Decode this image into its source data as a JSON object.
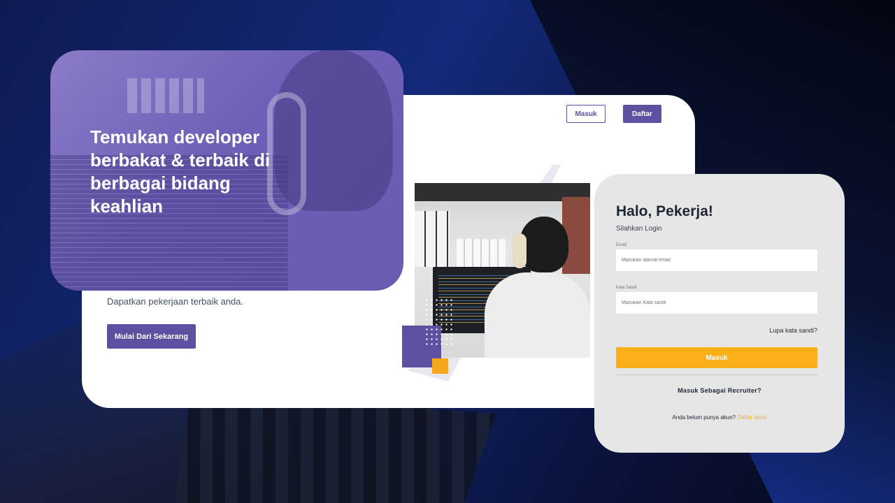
{
  "hero": {
    "title": "Temukan developer berbakat & terbaik di berbagai bidang keahlian"
  },
  "nav": {
    "login_label": "Masuk",
    "register_label": "Daftar"
  },
  "landing": {
    "subtitle": "Dapatkan pekerjaan terbaik anda.",
    "cta_label": "Mulai Dari Sekarang"
  },
  "login": {
    "title": "Halo, Pekerja!",
    "subtitle": "Silahkan Login",
    "email_label": "Email",
    "email_placeholder": "Masukan alamat email",
    "password_label": "Kata Sandi",
    "password_placeholder": "Masukan Kata sandi",
    "forgot_label": "Lupa kata sandi?",
    "submit_label": "Masuk",
    "recruiter_label": "Masuk Sebagai Recruiter?",
    "signup_prompt": "Anda belum punya akun?",
    "signup_link": "Daftar disini"
  },
  "colors": {
    "primary": "#5e50a1",
    "accent": "#fbaf18",
    "background": "#132a7a"
  }
}
